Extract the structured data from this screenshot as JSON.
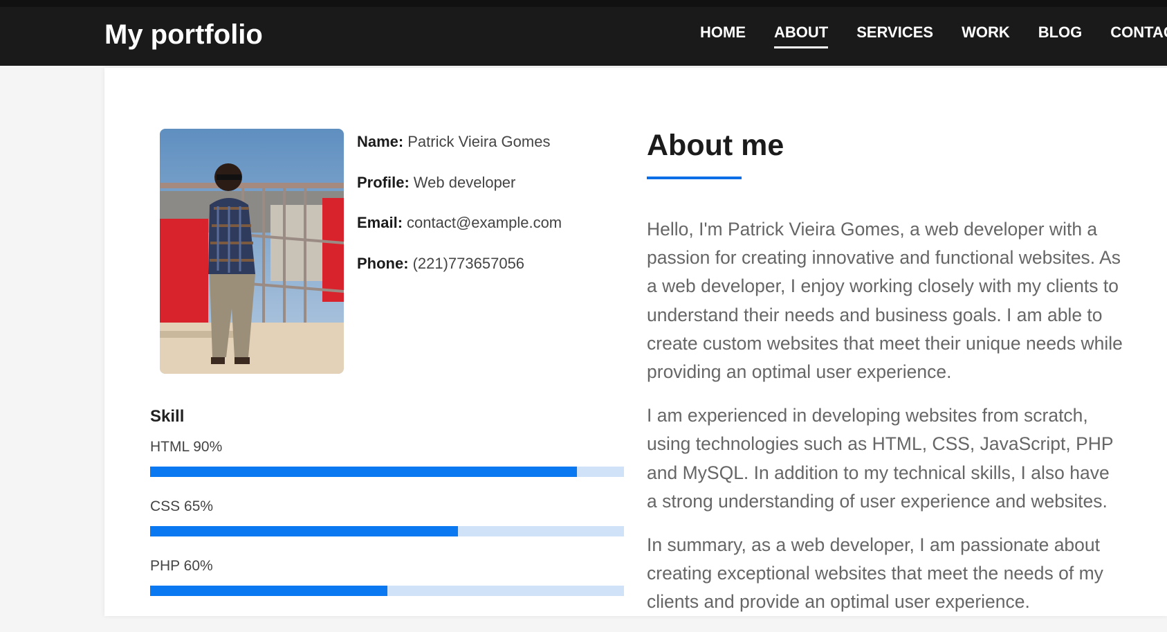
{
  "header": {
    "brand": "My portfolio",
    "nav": [
      "HOME",
      "ABOUT",
      "SERVICES",
      "WORK",
      "BLOG",
      "CONTACT"
    ],
    "active": "ABOUT"
  },
  "profile": {
    "name_label": "Name:",
    "name": "Patrick Vieira Gomes",
    "profile_label": "Profile:",
    "profile": "Web developer",
    "email_label": "Email:",
    "email": "contact@example.com",
    "phone_label": "Phone:",
    "phone": "(221)773657056"
  },
  "skills": {
    "title": "Skill",
    "items": [
      {
        "label": "HTML 90%",
        "percent": 90
      },
      {
        "label": "CSS 65%",
        "percent": 65
      },
      {
        "label": "PHP 60%",
        "percent": 50
      }
    ]
  },
  "about": {
    "title": "About me",
    "paragraphs": [
      "Hello, I'm Patrick Vieira Gomes, a web developer with a passion for creating innovative and functional websites. As a web developer, I enjoy working closely with my clients to understand their needs and business goals. I am able to create custom websites that meet their unique needs while providing an optimal user experience.",
      "I am experienced in developing websites from scratch, using technologies such as HTML, CSS, JavaScript, PHP and MySQL. In addition to my technical skills, I also have a strong understanding of user experience and websites.",
      "In summary, as a web developer, I am passionate about creating exceptional websites that meet the needs of my clients and provide an optimal user experience."
    ]
  },
  "colors": {
    "navbar": "#1a1a1a",
    "accent": "#0a78f0",
    "bar_track": "#cfe2f8"
  }
}
